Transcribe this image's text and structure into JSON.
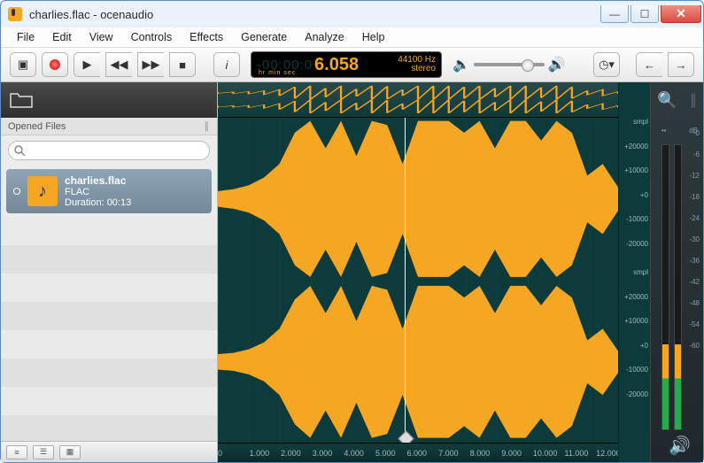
{
  "window": {
    "title": "charlies.flac - ocenaudio"
  },
  "menu": [
    "File",
    "Edit",
    "View",
    "Controls",
    "Effects",
    "Generate",
    "Analyze",
    "Help"
  ],
  "counter": {
    "neg": "-00:00:0",
    "pos": "6.058",
    "rate": "44100 Hz",
    "mode": "stereo",
    "units": "hr    min  sec"
  },
  "sidebar": {
    "header": "Opened Files",
    "search_placeholder": "",
    "file": {
      "name": "charlies.flac",
      "codec": "FLAC",
      "duration_label": "Duration: 00:13"
    }
  },
  "timeline": [
    "0",
    "1.000",
    "2.000",
    "3.000",
    "4.000",
    "5.000",
    "6.000",
    "7.000",
    "8.000",
    "9.000",
    "10.000",
    "11.000",
    "12.000"
  ],
  "scale_top": [
    "smpl",
    "+20000",
    "+10000",
    "+0",
    "-10000",
    "-20000"
  ],
  "scale_bot": [
    "smpl",
    "+20000",
    "+10000",
    "+0",
    "-10000",
    "-20000"
  ],
  "meter": {
    "left_label": "dB",
    "ticks": [
      "-0",
      "-6",
      "-12",
      "-18",
      "-24",
      "-30",
      "-36",
      "-42",
      "-48",
      "-54",
      "-60"
    ]
  },
  "chart_data": {
    "type": "waveform",
    "channels": 2,
    "sample_rate_hz": 44100,
    "duration_sec": 13.0,
    "amplitude_unit": "smpl",
    "amplitude_range": [
      -20000,
      20000
    ],
    "playhead_sec": 6.058,
    "envelope_x": [
      0,
      0.5,
      1,
      1.5,
      2,
      2.5,
      3,
      3.5,
      4,
      4.5,
      5,
      5.5,
      6,
      6.5,
      7,
      7.5,
      8,
      8.5,
      9,
      9.5,
      10,
      10.5,
      11,
      11.5,
      12,
      12.5,
      13
    ],
    "channel_left_peak": [
      2000,
      2500,
      3500,
      5500,
      9000,
      17000,
      20000,
      13000,
      20000,
      11000,
      20000,
      19000,
      9000,
      20000,
      20000,
      20000,
      17000,
      20000,
      13000,
      20000,
      20000,
      15000,
      20000,
      17000,
      6000,
      9000,
      3000
    ],
    "channel_right_peak": [
      2000,
      2300,
      3200,
      5000,
      8500,
      16000,
      19500,
      12500,
      19500,
      10500,
      19500,
      18500,
      8500,
      19500,
      19500,
      19500,
      16500,
      19500,
      12500,
      19500,
      19500,
      14500,
      19500,
      16500,
      5500,
      8500,
      2800
    ]
  }
}
